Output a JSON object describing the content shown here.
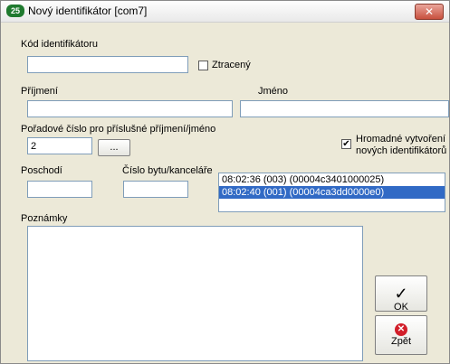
{
  "window": {
    "title": "Nový identifikátor [com7]",
    "close_glyph": "✕"
  },
  "fields": {
    "kod_label": "Kód identifikátoru",
    "kod_value": "",
    "ztraceny_label": "Ztracený",
    "ztraceny_checked": false,
    "prijmeni_label": "Příjmení",
    "prijmeni_value": "",
    "jmeno_label": "Jméno",
    "jmeno_value": "",
    "poradove_label": "Pořadové číslo pro příslušné příjmení/jméno",
    "poradove_value": "2",
    "browse_label": "...",
    "hromadne_label_line1": "Hromadné vytvoření",
    "hromadne_label_line2": "nových identifikátorů",
    "hromadne_checked": true,
    "poschodi_label": "Poschodí",
    "poschodi_value": "",
    "cislo_label": "Číslo bytu/kanceláře",
    "cislo_value": "",
    "poznamky_label": "Poznámky",
    "poznamky_value": ""
  },
  "log_list": {
    "items": [
      {
        "text": "08:02:36 (003) (00004c3401000025)",
        "selected": false
      },
      {
        "text": "08:02:40 (001) (00004ca3dd0000e0)",
        "selected": true
      }
    ]
  },
  "buttons": {
    "ok_label": "OK",
    "ok_icon": "✓",
    "back_label": "Zpět",
    "back_icon": "✕"
  },
  "colors": {
    "selection": "#316ac5",
    "close_button": "#c8503e",
    "back_icon": "#d21f2a"
  }
}
